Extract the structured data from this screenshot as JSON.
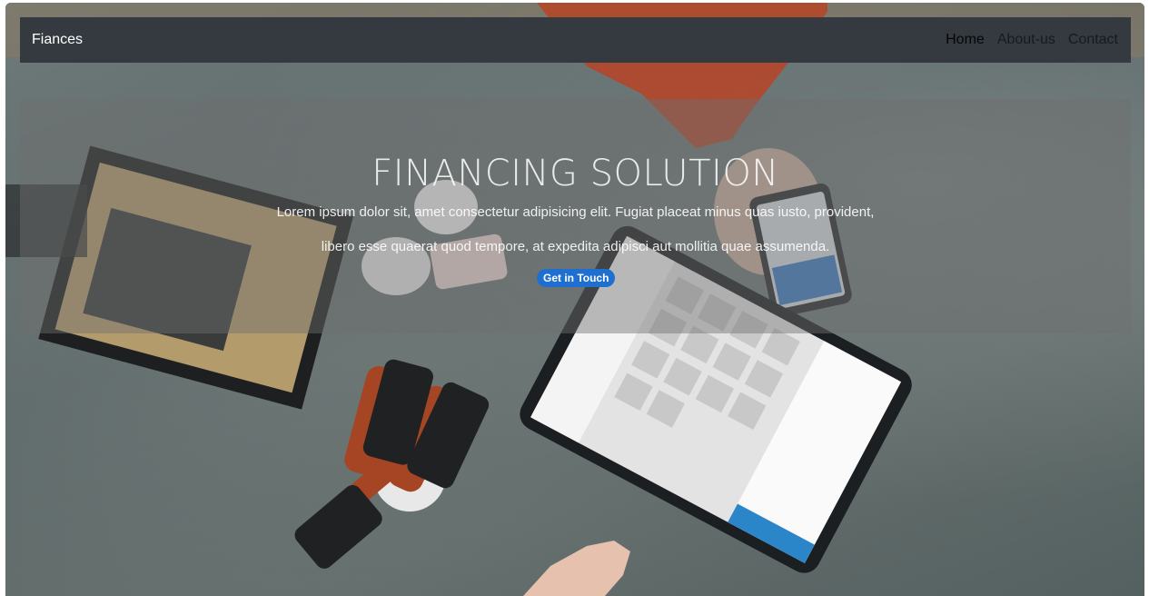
{
  "navbar": {
    "brand": "Fiances",
    "links": [
      {
        "label": "Home",
        "active": true
      },
      {
        "label": "About-us",
        "active": false
      },
      {
        "label": "Contact",
        "active": false
      }
    ]
  },
  "hero": {
    "title": "FINANCING SOLUTION",
    "text_line1": "Lorem ipsum dolor sit, amet consectetur adipisicing elit. Fugiat placeat minus quas iusto, provident,",
    "text_line2": "libero esse quaerat quod tempore, at expedita adipisci aut mollitia quae assumenda.",
    "button_label": "Get in Touch"
  },
  "colors": {
    "navbar_bg": "#343a40",
    "button_bg": "#1f6fd0",
    "overlay": "rgba(110,110,110,0.45)"
  }
}
